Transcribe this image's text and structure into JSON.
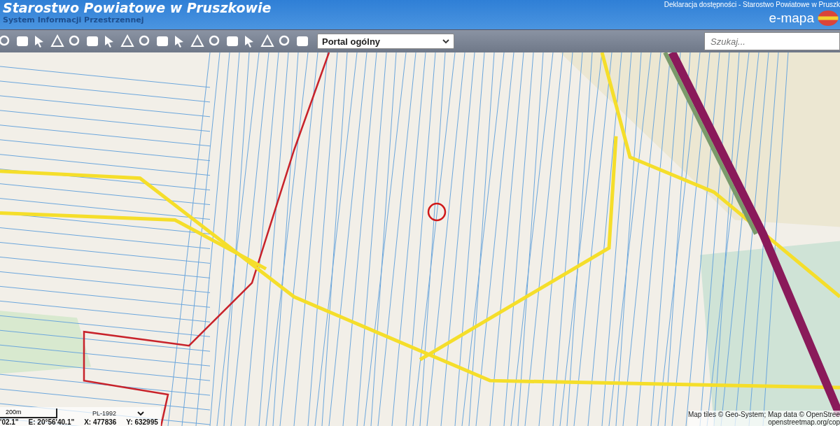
{
  "header": {
    "title": "Starostwo Powiatowe w Pruszkowie",
    "subtitle": "System Informacji Przestrzennej",
    "accessibility_link": "Deklaracja dostępności - Starostwo Powiatowe w Pruszk",
    "logo_text": "e-mapa"
  },
  "toolbar": {
    "portal_select": "Portal ogólny",
    "search": {
      "placeholder": "Szukaj..."
    }
  },
  "map": {
    "scale_label": "200m",
    "projection": "PL-1992",
    "coordinates": [
      "'02.1\"",
      "E: 20°56'40.1\"",
      "X: 477836",
      "Y: 632995"
    ],
    "attribution": [
      "Map tiles © Geo-System; Map data © OpenStree",
      "openstreetmap.org/cop"
    ]
  }
}
